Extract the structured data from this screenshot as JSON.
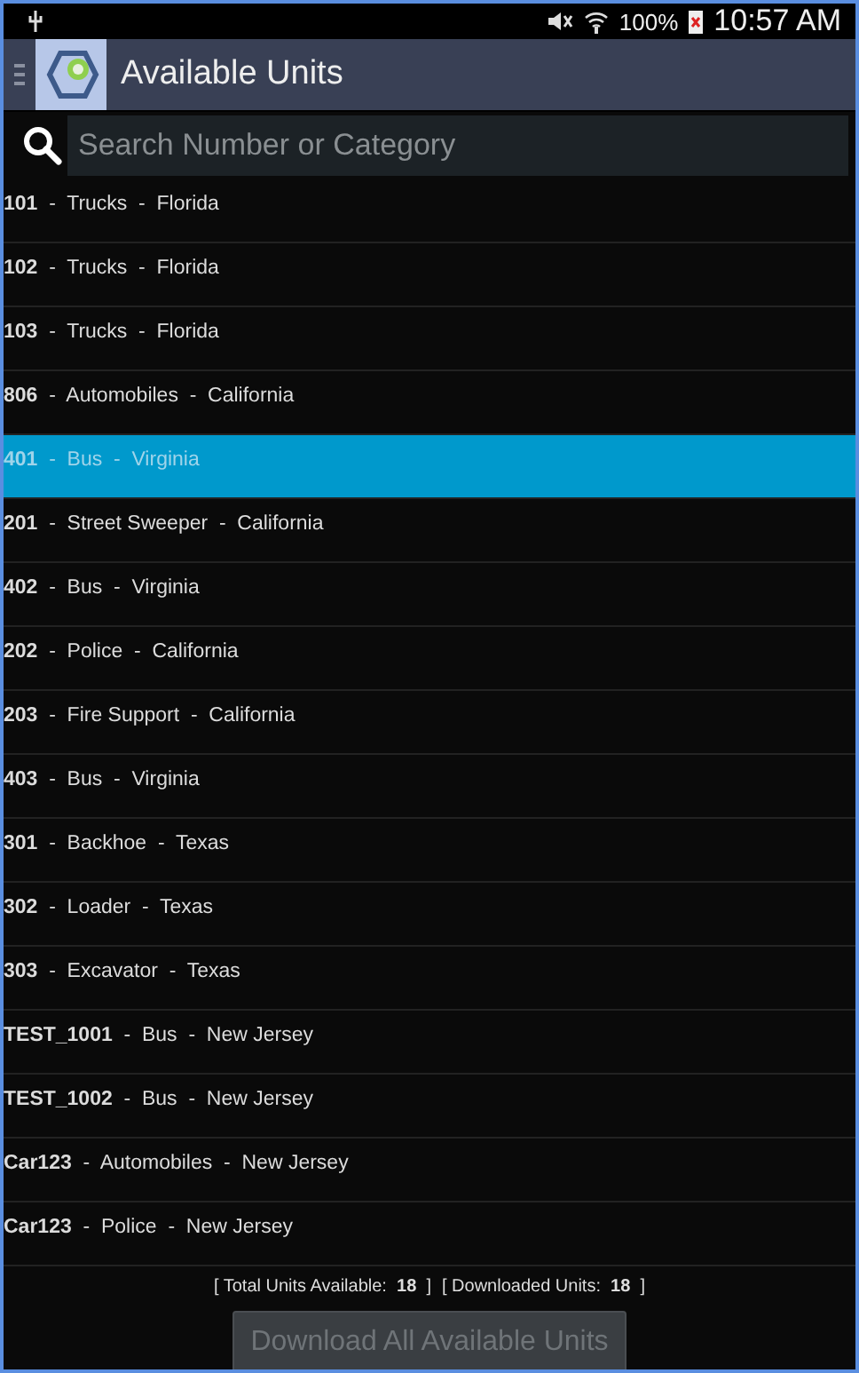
{
  "status_bar": {
    "battery": "100%",
    "time": "10:57 AM"
  },
  "app_bar": {
    "title": "Available Units"
  },
  "search": {
    "placeholder": "Search Number or Category"
  },
  "units": [
    {
      "text": "**101**  -  Trucks  -  Florida",
      "selected": false
    },
    {
      "text": "**102**  -  Trucks  -  Florida",
      "selected": false
    },
    {
      "text": "**103**  -  Trucks  -  Florida",
      "selected": false
    },
    {
      "text": "**806**  -  Automobiles  -  California",
      "selected": false
    },
    {
      "text": "**401**  -  Bus  -  Virginia",
      "selected": true
    },
    {
      "text": "**201**  -  Street Sweeper  -  California",
      "selected": false
    },
    {
      "text": "**402**  -  Bus  -  Virginia",
      "selected": false
    },
    {
      "text": "**202**  -  Police  -  California",
      "selected": false
    },
    {
      "text": "**203**  -  Fire Support  -  California",
      "selected": false
    },
    {
      "text": "**403**  -  Bus  -  Virginia",
      "selected": false
    },
    {
      "text": "**301**  -  Backhoe  -  Texas",
      "selected": false
    },
    {
      "text": "**302**  -  Loader  -  Texas",
      "selected": false
    },
    {
      "text": "**303**  -  Excavator  -  Texas",
      "selected": false
    },
    {
      "text": "**TEST_1001**  -  Bus  -  New Jersey",
      "selected": false
    },
    {
      "text": "**TEST_1002**  -  Bus  -  New Jersey",
      "selected": false
    },
    {
      "text": "**Car123**  -  Automobiles  -  New Jersey",
      "selected": false
    },
    {
      "text": "**Car123**  -  Police  -  New Jersey",
      "selected": false
    }
  ],
  "summary": [
    "[ Total Units Available:  **18**  ]",
    "[ Downloaded Units:  **18**  ]"
  ],
  "download_button": {
    "label": "Download All Available Units",
    "disabled": true
  }
}
